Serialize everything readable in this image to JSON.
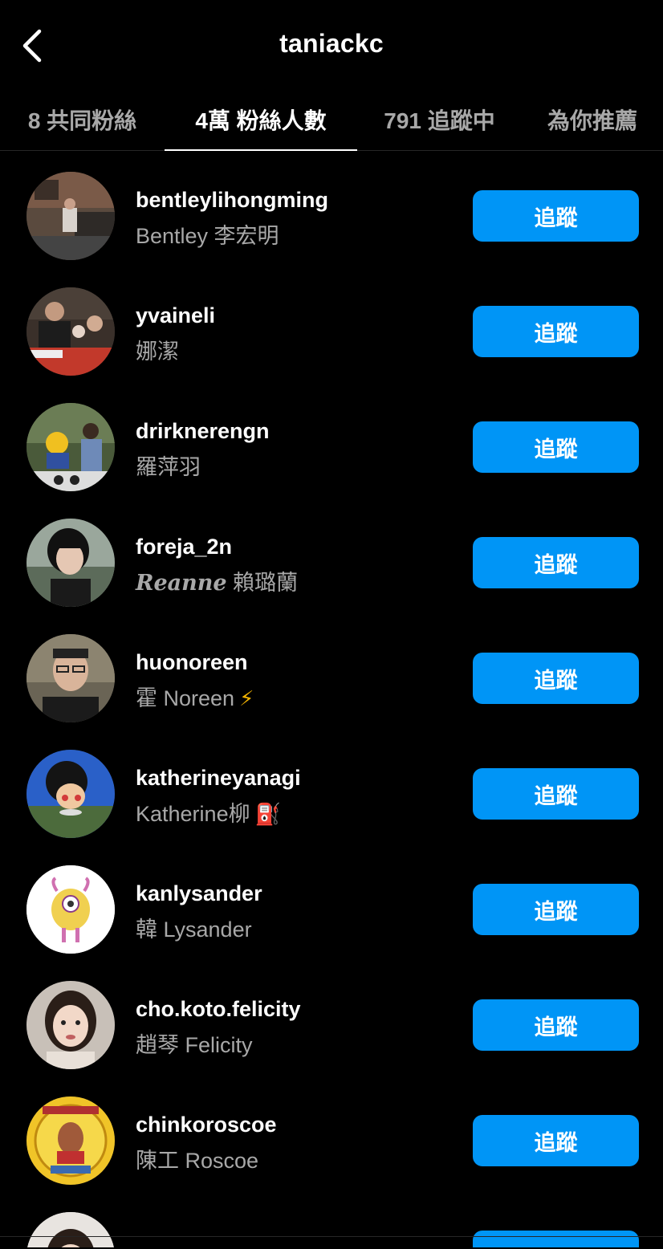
{
  "header": {
    "title": "taniackc"
  },
  "tabs": [
    {
      "label": "8 共同粉絲",
      "active": false
    },
    {
      "label": "4萬 粉絲人數",
      "active": true
    },
    {
      "label": "791 追蹤中",
      "active": false
    },
    {
      "label": "為你推薦",
      "active": false
    }
  ],
  "follow_label": "追蹤",
  "users": [
    {
      "username": "bentleylihongming",
      "name": "Bentley 李宏明",
      "emoji": ""
    },
    {
      "username": "yvaineli",
      "name": "娜潔",
      "emoji": ""
    },
    {
      "username": "drirknerengn",
      "name": "羅萍羽",
      "emoji": ""
    },
    {
      "username": "foreja_2n",
      "name_script": "Reanne",
      "name": "賴璐蘭",
      "emoji": ""
    },
    {
      "username": "huonoreen",
      "name": "霍 Noreen",
      "emoji": "⚡"
    },
    {
      "username": "katherineyanagi",
      "name": "Katherine柳",
      "emoji": "⛽"
    },
    {
      "username": "kanlysander",
      "name": "韓 Lysander",
      "emoji": ""
    },
    {
      "username": "cho.koto.felicity",
      "name": "趙琴 Felicity",
      "emoji": ""
    },
    {
      "username": "chinkoroscoe",
      "name": "陳工 Roscoe",
      "emoji": ""
    }
  ],
  "colors": {
    "background": "#000000",
    "follow_button": "#0095f6",
    "secondary_text": "#a8a8a8"
  }
}
